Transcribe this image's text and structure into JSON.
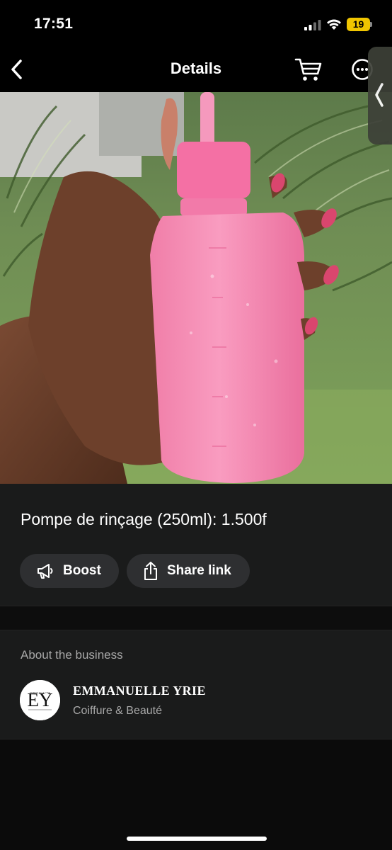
{
  "status_bar": {
    "time": "17:51",
    "battery_level": "19"
  },
  "nav": {
    "title": "Details",
    "back_icon": "chevron-left-icon",
    "cart_icon": "cart-icon",
    "more_icon": "ellipsis-circle-icon"
  },
  "product": {
    "title": "Pompe de rinçage (250ml): 1.500f",
    "image_description": "product-photo",
    "actions": {
      "boost_label": "Boost",
      "share_label": "Share link"
    }
  },
  "about": {
    "section_label": "About the business",
    "business_name": "EMMANUELLE YRIE",
    "business_category": "Coiffure & Beauté",
    "logo_monogram": "EY",
    "logo_small_text": "EMMANUELLE YRIE"
  },
  "colors": {
    "background": "#0b0b0b",
    "card": "#1a1b1b",
    "pill": "#2e2f31",
    "battery": "#f0c500",
    "muted_text": "#a8a8a8"
  }
}
